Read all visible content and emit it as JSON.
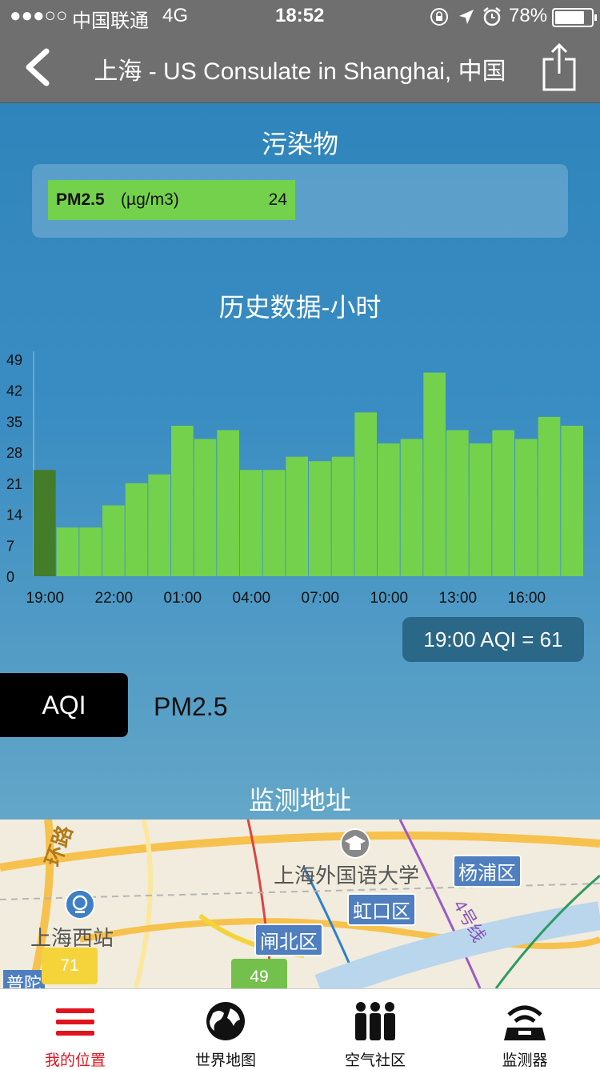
{
  "status_bar": {
    "signal": "●●●○○",
    "carrier": "中国联通",
    "network": "4G",
    "time": "18:52",
    "battery": "78%"
  },
  "nav": {
    "title": "上海 - US Consulate in Shanghai, 中国"
  },
  "pollutants": {
    "title": "污染物",
    "items": [
      {
        "name": "PM2.5",
        "unit": "(µg/m3)",
        "value": "24",
        "level": 0.49
      }
    ]
  },
  "history": {
    "title": "历史数据-小时",
    "readout": "19:00 AQI = 61",
    "tabs": {
      "aqi": "AQI",
      "pm25": "PM2.5"
    }
  },
  "chart_data": {
    "type": "bar",
    "title": "历史数据-小时",
    "yticks": [
      "0",
      "7",
      "14",
      "21",
      "28",
      "35",
      "42",
      "49"
    ],
    "ylim": [
      0,
      49
    ],
    "xticks": [
      "19:00",
      "22:00",
      "01:00",
      "04:00",
      "07:00",
      "10:00",
      "13:00",
      "16:00"
    ],
    "grid": false,
    "values": [
      24,
      11,
      11,
      16,
      21,
      23,
      34,
      31,
      33,
      24,
      24,
      27,
      26,
      27,
      37,
      30,
      31,
      46,
      33,
      30,
      33,
      31,
      36,
      34
    ],
    "highlight_index": 0,
    "colors": {
      "bar": "#74d14c",
      "highlight": "#437d2a"
    }
  },
  "map": {
    "title": "监测地址",
    "labels": [
      "上海外国语大学",
      "上海西站",
      "环路",
      "普陀"
    ],
    "districts": [
      "杨浦区",
      "虹口区",
      "闸北区"
    ],
    "line_label": "4号线",
    "markers": [
      {
        "value": "71",
        "color": "#f5d33b"
      },
      {
        "value": "49",
        "color": "#74c04c"
      }
    ]
  },
  "tabbar": {
    "items": [
      {
        "label": "我的位置",
        "icon": "menu-icon",
        "active": true
      },
      {
        "label": "世界地图",
        "icon": "globe-icon",
        "active": false
      },
      {
        "label": "空气社区",
        "icon": "people-icon",
        "active": false
      },
      {
        "label": "监测器",
        "icon": "monitor-icon",
        "active": false
      }
    ]
  }
}
